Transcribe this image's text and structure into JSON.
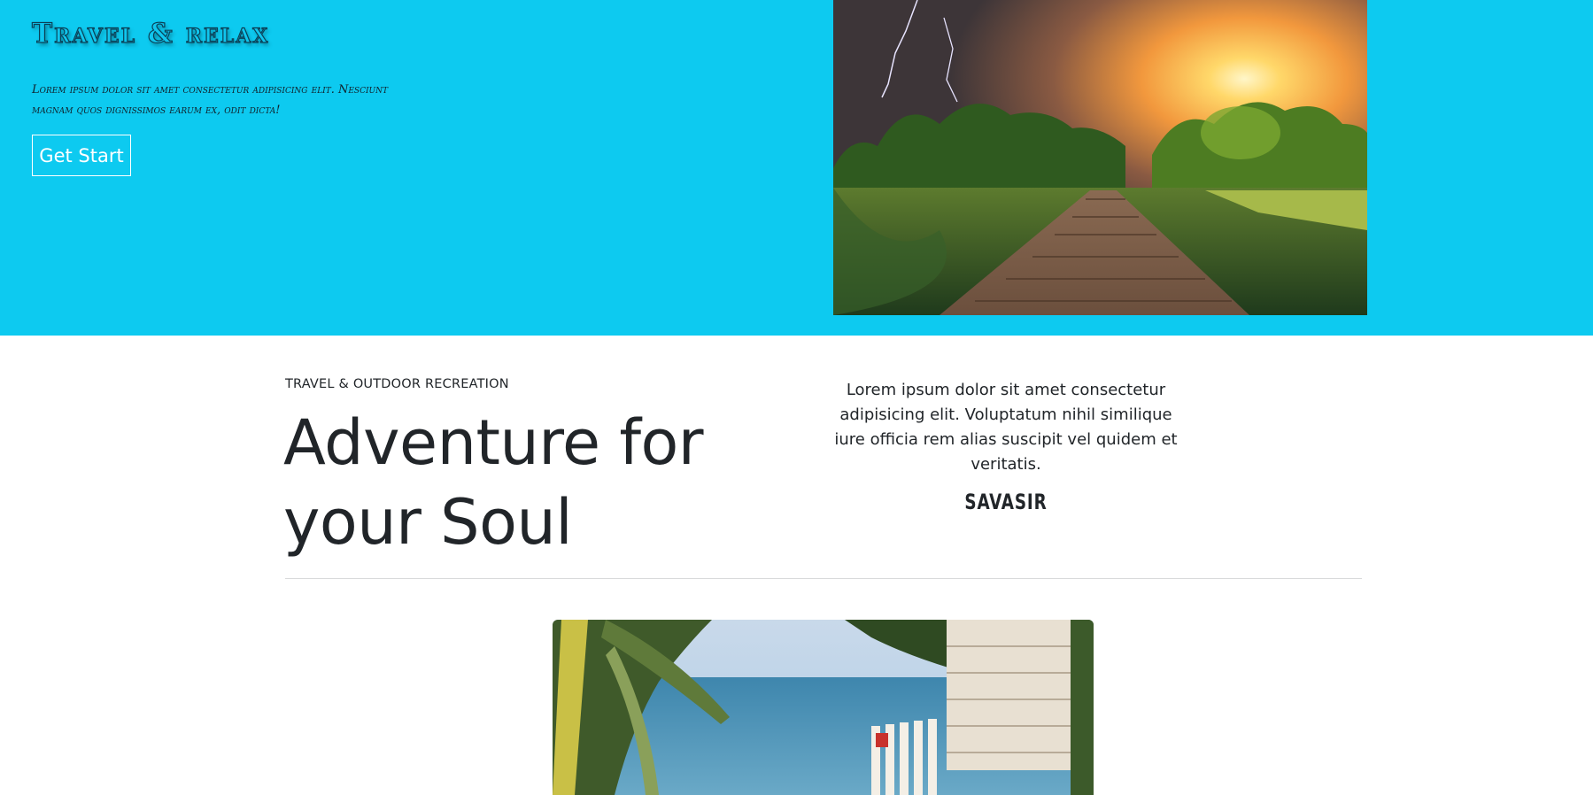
{
  "hero": {
    "title": "Travel & relax",
    "text": "Lorem ipsum dolor sit amet consectetur adipisicing elit. Nesciunt magnam quos dignissimos earum ex, odit dicta!",
    "button_label": "Get Start",
    "colors": {
      "background": "#0dcaf0",
      "button_border": "#ffffff"
    }
  },
  "intro": {
    "eyebrow": "TRAVEL & OUTDOOR RECREATION",
    "headline": "Adventure for your Soul",
    "quote": "Lorem ipsum dolor sit amet consectetur adipisicing elit. Voluptatum nihil similique iure officia rem alias suscipit vel quidem et veritatis.",
    "signature": "SAVASIR"
  }
}
